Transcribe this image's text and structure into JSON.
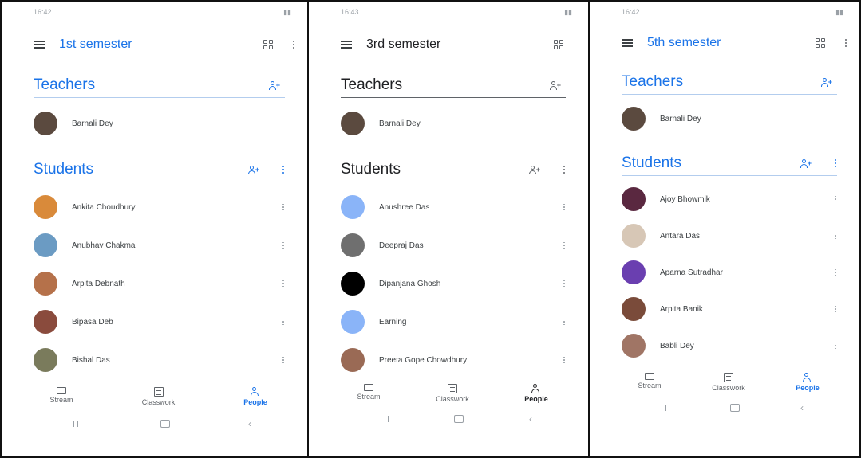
{
  "colors": {
    "accent": "#1a73e8",
    "text": "#202124",
    "secondary": "#5f6368"
  },
  "panels": [
    {
      "status_time": "16:42",
      "title": "1st semester",
      "theme": "blue",
      "teachers_label": "Teachers",
      "students_label": "Students",
      "teachers": [
        {
          "name": "Barnali Dey",
          "avatar": "#5b4a3f"
        }
      ],
      "students": [
        {
          "name": "Ankita Choudhury",
          "avatar": "#d98a3a"
        },
        {
          "name": "Anubhav Chakma",
          "avatar": "#6b9bc3"
        },
        {
          "name": "Arpita Debnath",
          "avatar": "#b5714a"
        },
        {
          "name": "Bipasa Deb",
          "avatar": "#8a4b3d"
        },
        {
          "name": "Bishal Das",
          "avatar": "#7a7b5c"
        }
      ],
      "nav": {
        "stream": "Stream",
        "classwork": "Classwork",
        "people": "People"
      }
    },
    {
      "status_time": "16:43",
      "title": "3rd semester",
      "theme": "dark",
      "teachers_label": "Teachers",
      "students_label": "Students",
      "teachers": [
        {
          "name": "Barnali Dey",
          "avatar": "#5b4a3f"
        }
      ],
      "students": [
        {
          "name": "Anushree Das",
          "avatar": "#8ab4f8"
        },
        {
          "name": "Deepraj Das",
          "avatar": "#6f6f6f"
        },
        {
          "name": "Dipanjana Ghosh",
          "avatar": "#000000"
        },
        {
          "name": "Earning",
          "avatar": "#8ab4f8"
        },
        {
          "name": "Preeta Gope Chowdhury",
          "avatar": "#9a6a55"
        }
      ],
      "nav": {
        "stream": "Stream",
        "classwork": "Classwork",
        "people": "People"
      }
    },
    {
      "status_time": "16:42",
      "title": "5th semester",
      "theme": "blue",
      "teachers_label": "Teachers",
      "students_label": "Students",
      "teachers": [
        {
          "name": "Barnali Dey",
          "avatar": "#5b4a3f"
        }
      ],
      "students": [
        {
          "name": "Ajoy Bhowmik",
          "avatar": "#5a2840"
        },
        {
          "name": "Antara Das",
          "avatar": "#d7c7b6"
        },
        {
          "name": "Aparna Sutradhar",
          "avatar": "#6a3fb0"
        },
        {
          "name": "Arpita Banik",
          "avatar": "#7a4b3a"
        },
        {
          "name": "Babli Dey",
          "avatar": "#a07565"
        }
      ],
      "nav": {
        "stream": "Stream",
        "classwork": "Classwork",
        "people": "People"
      }
    }
  ]
}
